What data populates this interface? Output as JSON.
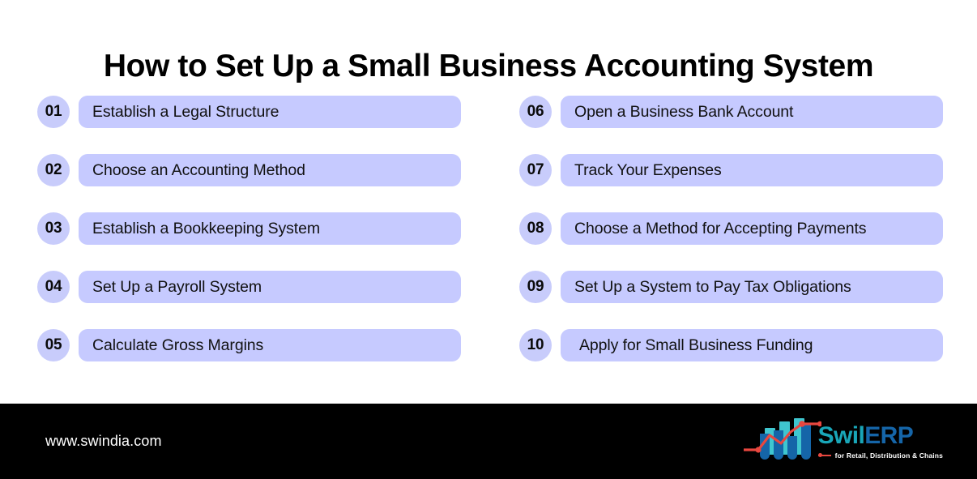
{
  "page": {
    "title": "How to Set Up a Small Business Accounting System",
    "background_color": "#ffffff",
    "accent_color": "#c6caff",
    "badge_color": "#c8ccfb",
    "text_color": "#111111"
  },
  "steps": {
    "left": [
      {
        "number": "01",
        "label": "Establish a Legal Structure"
      },
      {
        "number": "02",
        "label": "Choose an Accounting Method"
      },
      {
        "number": "03",
        "label": "Establish a Bookkeeping System"
      },
      {
        "number": "04",
        "label": "Set Up a Payroll System"
      },
      {
        "number": "05",
        "label": "Calculate Gross Margins"
      }
    ],
    "right": [
      {
        "number": "06",
        "label": "Open a Business Bank Account"
      },
      {
        "number": "07",
        "label": "Track Your Expenses"
      },
      {
        "number": "08",
        "label": "Choose a Method for Accepting Payments"
      },
      {
        "number": "09",
        "label": "Set Up a System to Pay Tax Obligations"
      },
      {
        "number": "10",
        "label": "Apply for Small Business Funding"
      }
    ]
  },
  "footer": {
    "background_color": "#000000",
    "url": "www.swindia.com",
    "logo": {
      "wordmark_primary": "Swil",
      "wordmark_secondary": "ERP",
      "tagline": "for Retail, Distribution & Chains",
      "primary_color": "#19a6b8",
      "secondary_color": "#1565a8",
      "line_color": "#e8473f",
      "bar_color_back": "#3fc6cf",
      "bar_color_front": "#1565a8"
    }
  }
}
